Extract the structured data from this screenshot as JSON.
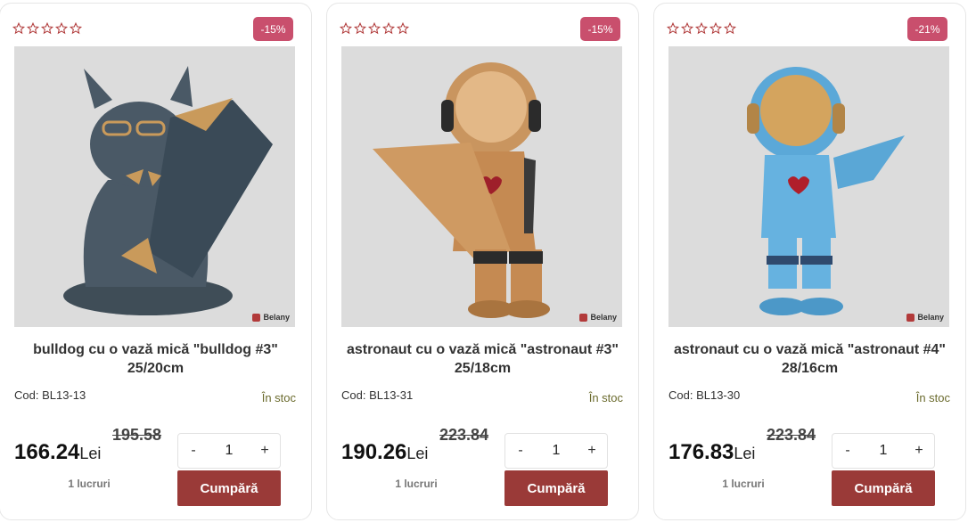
{
  "products": [
    {
      "discount": "-15%",
      "title_line1": "bulldog cu o vază mică \"bulldog #3\"",
      "title_line2": "25/20cm",
      "code": "Cod: BL13-13",
      "stock": "În stoc",
      "old_price": "195.58",
      "price": "166.24",
      "currency": "Lei",
      "quantity": "1",
      "lucruri": "1 lucruri",
      "minus": "-",
      "plus": "+",
      "buy_label": "Cumpără",
      "brand": "Belany",
      "rating": 0
    },
    {
      "discount": "-15%",
      "title_line1": "astronaut cu o vază mică \"astronaut #3\"",
      "title_line2": "25/18cm",
      "code": "Cod: BL13-31",
      "stock": "În stoc",
      "old_price": "223.84",
      "price": "190.26",
      "currency": "Lei",
      "quantity": "1",
      "lucruri": "1 lucruri",
      "minus": "-",
      "plus": "+",
      "buy_label": "Cumpără",
      "brand": "Belany",
      "rating": 0
    },
    {
      "discount": "-21%",
      "title_line1": "astronaut cu o vază mică \"astronaut #4\"",
      "title_line2": "28/16cm",
      "code": "Cod: BL13-30",
      "stock": "În stoc",
      "old_price": "223.84",
      "price": "176.83",
      "currency": "Lei",
      "quantity": "1",
      "lucruri": "1 lucruri",
      "minus": "-",
      "plus": "+",
      "buy_label": "Cumpără",
      "brand": "Belany",
      "rating": 0
    }
  ],
  "colors": {
    "badge": "#c94f6d",
    "buy_button": "#9a3a38",
    "stock_text": "#6b6b2e",
    "star_outline": "#b03a3a"
  },
  "icons": {
    "star": "star-outline-icon",
    "brand": "belany-logo-icon"
  }
}
